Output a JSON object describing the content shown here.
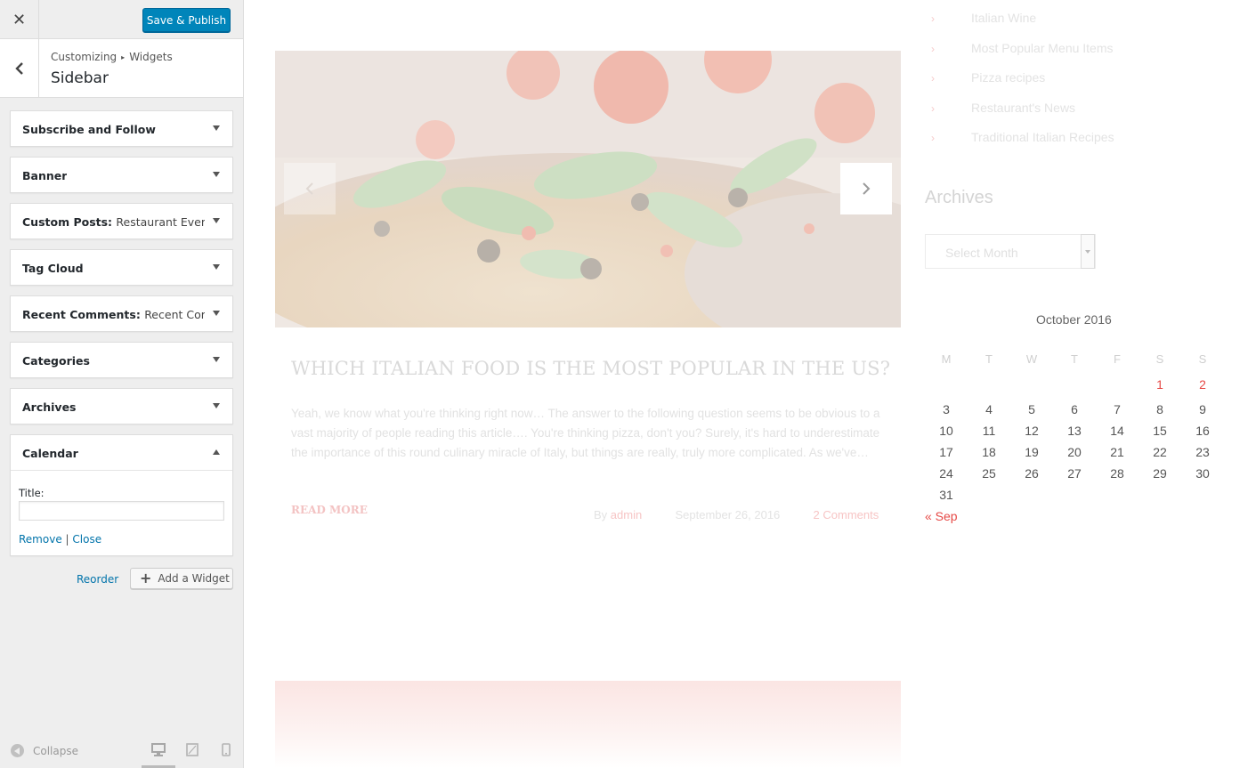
{
  "customizer": {
    "close_symbol": "✕",
    "save_label": "Save & Publish",
    "breadcrumb_root": "Customizing",
    "breadcrumb_sep": "▸",
    "breadcrumb_current": "Widgets",
    "section_title": "Sidebar",
    "widgets": [
      {
        "name": "Subscribe and Follow",
        "sub": ""
      },
      {
        "name": "Banner",
        "sub": ""
      },
      {
        "name": "Custom Posts:",
        "sub": "Restaurant Events"
      },
      {
        "name": "Tag Cloud",
        "sub": ""
      },
      {
        "name": "Recent Comments:",
        "sub": "Recent Com..."
      },
      {
        "name": "Categories",
        "sub": ""
      },
      {
        "name": "Archives",
        "sub": ""
      },
      {
        "name": "Calendar",
        "sub": ""
      }
    ],
    "calendar_form": {
      "title_label": "Title:",
      "title_value": "",
      "remove_label": "Remove",
      "divider": "|",
      "close_label": "Close"
    },
    "reorder_label": "Reorder",
    "add_widget_label": "Add a Widget",
    "collapse_label": "Collapse"
  },
  "preview": {
    "categories": [
      "Italian Wine",
      "Most Popular Menu Items",
      "Pizza recipes",
      "Restaurant's News",
      "Traditional Italian Recipes"
    ],
    "post": {
      "title": "WHICH ITALIAN FOOD IS THE MOST POPULAR IN THE US?",
      "excerpt": "Yeah, we know what you're thinking right now… The answer to the following question seems to be obvious to a vast majority of people reading this article…. You're thinking pizza, don't you? Surely, it's hard to underestimate the importance of this round culinary miracle of Italy, but things are really, truly more complicated. As we've…",
      "read_more": "READ MORE",
      "by": "By",
      "author": "admin",
      "date": "September 26, 2016",
      "comments": "2 Comments"
    },
    "archives_title": "Archives",
    "archive_select": "Select Month",
    "calendar": {
      "caption": "October 2016",
      "weekdays": [
        "M",
        "T",
        "W",
        "T",
        "F",
        "S",
        "S"
      ],
      "weeks": [
        [
          "",
          "",
          "",
          "",
          "",
          "1",
          "2"
        ],
        [
          "3",
          "4",
          "5",
          "6",
          "7",
          "8",
          "9"
        ],
        [
          "10",
          "11",
          "12",
          "13",
          "14",
          "15",
          "16"
        ],
        [
          "17",
          "18",
          "19",
          "20",
          "21",
          "22",
          "23"
        ],
        [
          "24",
          "25",
          "26",
          "27",
          "28",
          "29",
          "30"
        ],
        [
          "31",
          "",
          "",
          "",
          "",
          "",
          ""
        ]
      ],
      "linked_days": [
        "1",
        "2"
      ],
      "prev_link": "« Sep"
    }
  },
  "colors": {
    "save_button": "#0085ba",
    "link_blue": "#0073aa",
    "calendar_link_red": "#e64946",
    "sidebar_bg": "#eeeeee"
  },
  "icons": {
    "back": "chevron-left-icon",
    "add": "plus-icon",
    "collapse": "collapse-arrow-icon",
    "desktop": "desktop-icon",
    "tablet": "tablet-icon",
    "mobile": "mobile-icon",
    "slider_prev": "chevron-left-icon",
    "slider_next": "chevron-right-icon",
    "category_bullet": "chevron-right-icon"
  }
}
